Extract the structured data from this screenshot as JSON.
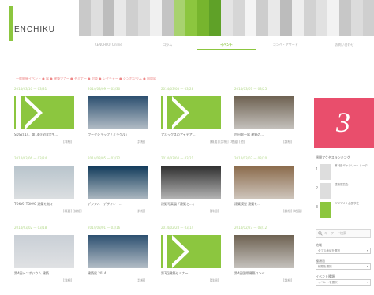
{
  "header": {
    "logo_text": "ENCHIKU",
    "stripes": [
      "#c9c9c9",
      "#dedede",
      "#bdbdbd",
      "#e8e8e8",
      "#cfcfcf",
      "#dcdcdc",
      "#f0f0f0",
      "#c4c4c4",
      "#a8d26f",
      "#8cc63f",
      "#77b52e",
      "#5fa128",
      "#e4e4e4",
      "#d6d6d6",
      "#f4f4f4",
      "#cdcdcd",
      "#e9e9e9",
      "#bcbcbc",
      "#eeeeee",
      "#d2d2d2",
      "#e1e1e1",
      "#f2f2f2",
      "#c7c7c7",
      "#dcdcdc",
      "#cfcfcf"
    ]
  },
  "nav": {
    "items": [
      "KENCHIKU Online",
      "コラム",
      "イベント",
      "コンペ・アワード",
      "お問い合わせ"
    ],
    "active_index": 2
  },
  "category_bar": "一般開催イベント ● 展 ● 建築ツアー ● セミナー ● 対談 ● レクチャー ● シンポジウム ● 国際展",
  "cards": [
    {
      "date": "2014/03/10 — 03/31",
      "title": "SDS2014、第14回全国学生...",
      "more": "[詳細]",
      "thumb": "green"
    },
    {
      "date": "2014/03/09 — 03/30",
      "title": "ワークショップ「ミラクル」",
      "more": "[詳細]",
      "thumb": "photo"
    },
    {
      "date": "2014/03/08 — 03/28",
      "title": "アネックスのアイデア...",
      "more": "[概要] [詳細] [地図] [他]",
      "thumb": "green"
    },
    {
      "date": "2014/03/07 — 03/25",
      "title": "内田聡一展 建築の...",
      "more": "[詳細]",
      "thumb": "photo"
    },
    {
      "date": "2014/03/06 — 03/24",
      "title": "TOKYO TOKYO 建築を紡ぐ",
      "more": "[概要] [詳細]",
      "thumb": "photo"
    },
    {
      "date": "2014/03/05 — 03/22",
      "title": "デジタル・デザイン・...",
      "more": "[詳細]",
      "thumb": "photo"
    },
    {
      "date": "2014/03/04 — 03/21",
      "title": "建築写真展「建築と...」",
      "more": "[詳細]",
      "thumb": "photo"
    },
    {
      "date": "2014/03/03 — 03/20",
      "title": "建築模型 建築を...",
      "more": "[詳細] [地図]",
      "thumb": "photo"
    },
    {
      "date": "2014/03/02 — 03/18",
      "title": "第4回シンポジウム 建築...",
      "more": "[詳細]",
      "thumb": "photo"
    },
    {
      "date": "2014/03/01 — 03/16",
      "title": "建築展 2014",
      "more": "[詳細]",
      "thumb": "photo"
    },
    {
      "date": "2014/02/28 — 03/14",
      "title": "第3回建築セミナー",
      "more": "[詳細]",
      "thumb": "green"
    },
    {
      "date": "2014/02/27 — 03/12",
      "title": "第4回国際建築コンペ...",
      "more": "[詳細]",
      "thumb": "photo"
    }
  ],
  "sidebar": {
    "badge_number": "3",
    "ranking_heading": "週間アクセスランキング",
    "ranking": [
      {
        "num": "1",
        "text": "第3回 ギャラリー・トーク",
        "thumb": "photo"
      },
      {
        "num": "2",
        "text": "建築展覧会",
        "thumb": "photo"
      },
      {
        "num": "3",
        "text": "SDS2014 全国学生...",
        "thumb": "green"
      }
    ],
    "search_placeholder": "キーワード検索",
    "filters": [
      {
        "label": "地域",
        "value": "全ての地域を選択"
      },
      {
        "label": "種類別",
        "value": "種類を選択"
      },
      {
        "label": "イベント種類",
        "value": "イベントを選択"
      }
    ]
  }
}
